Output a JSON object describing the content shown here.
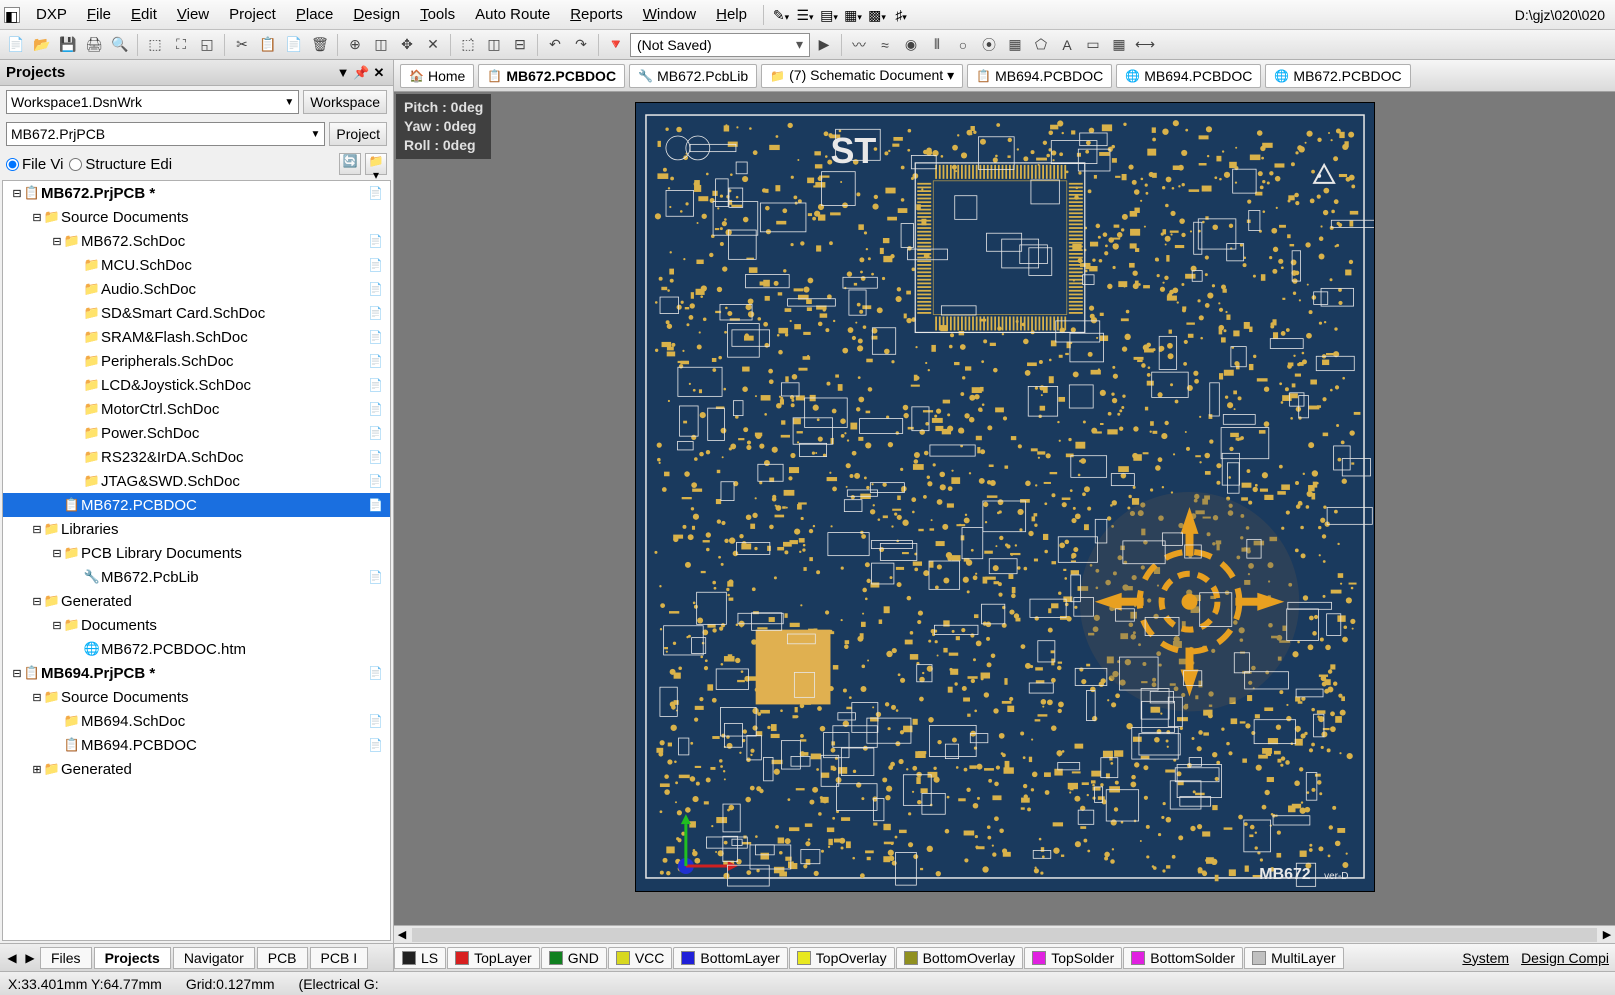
{
  "menubar": {
    "items": [
      "DXP",
      "File",
      "Edit",
      "View",
      "Project",
      "Place",
      "Design",
      "Tools",
      "Auto Route",
      "Reports",
      "Window",
      "Help"
    ],
    "hotchars": [
      -1,
      0,
      0,
      0,
      3,
      0,
      0,
      0,
      -1,
      0,
      0,
      0
    ],
    "path": "D:\\gjz\\020\\020"
  },
  "toolbar": {
    "not_saved": "(Not Saved)"
  },
  "projects_panel": {
    "title": "Projects",
    "workspace_value": "Workspace1.DsnWrk",
    "workspace_btn": "Workspace",
    "project_value": "MB672.PrjPCB",
    "project_btn": "Project",
    "radio_file": "File Vi",
    "radio_struct": "Structure Edi"
  },
  "tree": [
    {
      "indent": 0,
      "exp": "⊟",
      "icon": "📋",
      "iconc": "i-pcb",
      "label": "MB672.PrjPCB *",
      "bold": true,
      "right": "📄",
      "rightc": "i-red"
    },
    {
      "indent": 1,
      "exp": "⊟",
      "icon": "📁",
      "iconc": "i-fold",
      "label": "Source Documents"
    },
    {
      "indent": 2,
      "exp": "⊟",
      "icon": "📁",
      "iconc": "i-fold",
      "label": "MB672.SchDoc",
      "right": "📄"
    },
    {
      "indent": 3,
      "icon": "📁",
      "iconc": "i-fold",
      "label": "MCU.SchDoc",
      "right": "📄"
    },
    {
      "indent": 3,
      "icon": "📁",
      "iconc": "i-fold",
      "label": "Audio.SchDoc",
      "right": "📄"
    },
    {
      "indent": 3,
      "icon": "📁",
      "iconc": "i-fold",
      "label": "SD&Smart Card.SchDoc",
      "right": "📄"
    },
    {
      "indent": 3,
      "icon": "📁",
      "iconc": "i-fold",
      "label": "SRAM&Flash.SchDoc",
      "right": "📄"
    },
    {
      "indent": 3,
      "icon": "📁",
      "iconc": "i-fold",
      "label": "Peripherals.SchDoc",
      "right": "📄"
    },
    {
      "indent": 3,
      "icon": "📁",
      "iconc": "i-fold",
      "label": "LCD&Joystick.SchDoc",
      "right": "📄"
    },
    {
      "indent": 3,
      "icon": "📁",
      "iconc": "i-fold",
      "label": "MotorCtrl.SchDoc",
      "right": "📄"
    },
    {
      "indent": 3,
      "icon": "📁",
      "iconc": "i-fold",
      "label": "Power.SchDoc",
      "right": "📄"
    },
    {
      "indent": 3,
      "icon": "📁",
      "iconc": "i-fold",
      "label": "RS232&IrDA.SchDoc",
      "right": "📄"
    },
    {
      "indent": 3,
      "icon": "📁",
      "iconc": "i-fold",
      "label": "JTAG&SWD.SchDoc",
      "right": "📄"
    },
    {
      "indent": 2,
      "icon": "📋",
      "iconc": "i-pcb",
      "label": "MB672.PCBDOC",
      "right": "📄",
      "selected": true
    },
    {
      "indent": 1,
      "exp": "⊟",
      "icon": "📁",
      "iconc": "i-fold",
      "label": "Libraries"
    },
    {
      "indent": 2,
      "exp": "⊟",
      "icon": "📁",
      "iconc": "i-fold",
      "label": "PCB Library Documents"
    },
    {
      "indent": 3,
      "icon": "🔧",
      "iconc": "i-sch",
      "label": "MB672.PcbLib",
      "right": "📄"
    },
    {
      "indent": 1,
      "exp": "⊟",
      "icon": "📁",
      "iconc": "i-fold",
      "label": "Generated"
    },
    {
      "indent": 2,
      "exp": "⊟",
      "icon": "📁",
      "iconc": "i-fold",
      "label": "Documents"
    },
    {
      "indent": 3,
      "icon": "🌐",
      "iconc": "i-sch",
      "label": "MB672.PCBDOC.htm"
    },
    {
      "indent": 0,
      "exp": "⊟",
      "icon": "📋",
      "iconc": "i-pcb",
      "label": "MB694.PrjPCB *",
      "bold": true,
      "right": "📄",
      "rightc": "i-red"
    },
    {
      "indent": 1,
      "exp": "⊟",
      "icon": "📁",
      "iconc": "i-fold",
      "label": "Source Documents"
    },
    {
      "indent": 2,
      "icon": "📁",
      "iconc": "i-fold",
      "label": "MB694.SchDoc",
      "right": "📄"
    },
    {
      "indent": 2,
      "icon": "📋",
      "iconc": "i-pcb",
      "label": "MB694.PCBDOC",
      "right": "📄"
    },
    {
      "indent": 1,
      "exp": "⊞",
      "icon": "📁",
      "iconc": "i-fold",
      "label": "Generated"
    }
  ],
  "doc_tabs": [
    {
      "icon": "🏠",
      "label": "Home",
      "home": true
    },
    {
      "icon": "📋",
      "label": "MB672.PCBDOC",
      "active": true
    },
    {
      "icon": "🔧",
      "label": "MB672.PcbLib"
    },
    {
      "icon": "📁",
      "label": "(7) Schematic Document ▾"
    },
    {
      "icon": "📋",
      "label": "MB694.PCBDOC"
    },
    {
      "icon": "🌐",
      "label": "MB694.PCBDOC"
    },
    {
      "icon": "🌐",
      "label": "MB672.PCBDOC"
    }
  ],
  "hud": {
    "pitch": "Pitch : 0deg",
    "yaw": "Yaw  : 0deg",
    "roll": "Roll : 0deg"
  },
  "board": {
    "logo": "ST",
    "name": "MB672",
    "rev": "ver-D"
  },
  "layers": [
    {
      "color": "#202020",
      "label": "LS"
    },
    {
      "color": "#d82020",
      "label": "TopLayer"
    },
    {
      "color": "#108020",
      "label": "GND"
    },
    {
      "color": "#d8d820",
      "label": "VCC"
    },
    {
      "color": "#2020d8",
      "label": "BottomLayer"
    },
    {
      "color": "#e8e820",
      "label": "TopOverlay"
    },
    {
      "color": "#909020",
      "label": "BottomOverlay"
    },
    {
      "color": "#e020e0",
      "label": "TopSolder"
    },
    {
      "color": "#e020e0",
      "label": "BottomSolder"
    },
    {
      "color": "#c0c0c0",
      "label": "MultiLayer"
    }
  ],
  "panel_tabs": [
    "Files",
    "Projects",
    "Navigator",
    "PCB",
    "PCB I"
  ],
  "panel_tabs_active": 1,
  "sys_menus": [
    "System",
    "Design Compi"
  ],
  "status": {
    "xy": "X:33.401mm Y:64.77mm",
    "grid": "Grid:0.127mm",
    "snap": "(Electrical G:"
  }
}
